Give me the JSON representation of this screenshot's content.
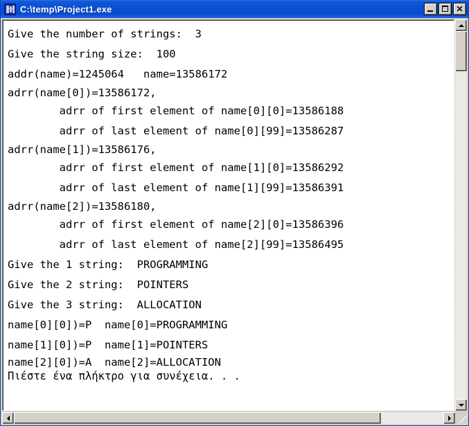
{
  "window": {
    "title": "C:\\temp\\Project1.exe",
    "icon": "console-app-icon",
    "buttons": {
      "minimize": "_",
      "maximize": "□",
      "close": "✕"
    }
  },
  "console": {
    "lines": [
      {
        "text": "Give the number of strings:  3",
        "spacing": "normal"
      },
      {
        "text": "Give the string size:  100",
        "spacing": "normal"
      },
      {
        "text": "addr(name)=1245064   name=13586172",
        "spacing": "normal"
      },
      {
        "text": "adrr(name[0])=13586172,",
        "spacing": "tight"
      },
      {
        "text": "        adrr of first element of name[0][0]=13586188",
        "spacing": "normal"
      },
      {
        "text": "        adrr of last element of name[0][99]=13586287",
        "spacing": "normal"
      },
      {
        "text": "adrr(name[1])=13586176,",
        "spacing": "tight"
      },
      {
        "text": "        adrr of first element of name[1][0]=13586292",
        "spacing": "normal"
      },
      {
        "text": "        adrr of last element of name[1][99]=13586391",
        "spacing": "normal"
      },
      {
        "text": "adrr(name[2])=13586180,",
        "spacing": "tight"
      },
      {
        "text": "        adrr of first element of name[2][0]=13586396",
        "spacing": "normal"
      },
      {
        "text": "        adrr of last element of name[2][99]=13586495",
        "spacing": "normal"
      },
      {
        "text": "Give the 1 string:  PROGRAMMING",
        "spacing": "normal"
      },
      {
        "text": "Give the 2 string:  POINTERS",
        "spacing": "normal"
      },
      {
        "text": "Give the 3 string:  ALLOCATION",
        "spacing": "normal"
      },
      {
        "text": "name[0][0])=P  name[0]=PROGRAMMING",
        "spacing": "normal"
      },
      {
        "text": "name[1][0])=P  name[1]=POINTERS",
        "spacing": "normal"
      },
      {
        "text": "name[2][0])=A  name[2]=ALLOCATION",
        "spacing": "last"
      },
      {
        "text": "Πιέστε ένα πλήκτρο για συνέχεια. . .",
        "spacing": "last"
      }
    ],
    "background_color": "#ffffff",
    "text_color": "#000000"
  },
  "scrollbars": {
    "vertical": {
      "up_arrow": "▲",
      "down_arrow": "▼"
    },
    "horizontal": {
      "left_arrow": "◀",
      "right_arrow": "▶"
    }
  },
  "colors": {
    "titlebar": "#0a4fd4",
    "chrome": "#d4d0c8",
    "console_bg": "#ffffff",
    "console_fg": "#000000"
  }
}
